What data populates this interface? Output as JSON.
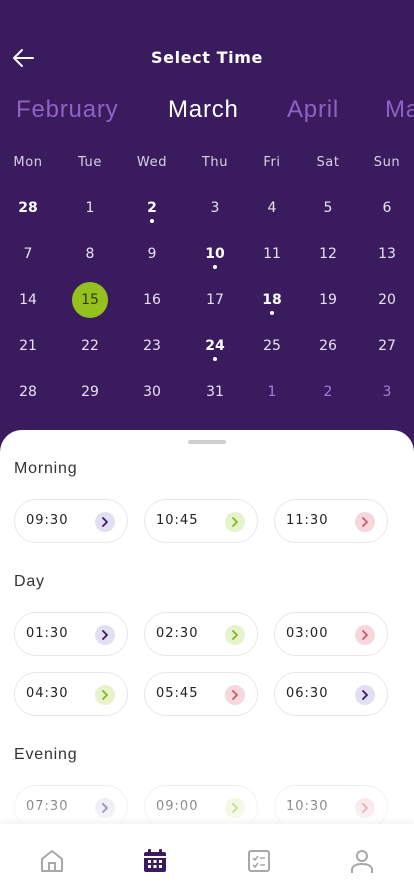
{
  "header": {
    "title": "Select Time",
    "months": [
      "February",
      "March",
      "April",
      "Ma"
    ],
    "active_month": "March",
    "weekdays": [
      "Mon",
      "Tue",
      "Wed",
      "Thu",
      "Fri",
      "Sat",
      "Sun"
    ]
  },
  "calendar": {
    "selected": "15",
    "weeks": [
      [
        {
          "d": "28",
          "bold": true
        },
        {
          "d": "1"
        },
        {
          "d": "2",
          "bold": true,
          "dot": true
        },
        {
          "d": "3"
        },
        {
          "d": "4"
        },
        {
          "d": "5"
        },
        {
          "d": "6"
        }
      ],
      [
        {
          "d": "7"
        },
        {
          "d": "8"
        },
        {
          "d": "9"
        },
        {
          "d": "10",
          "bold": true,
          "dot": true
        },
        {
          "d": "11"
        },
        {
          "d": "12"
        },
        {
          "d": "13"
        }
      ],
      [
        {
          "d": "14"
        },
        {
          "d": "15",
          "selected": true
        },
        {
          "d": "16"
        },
        {
          "d": "17"
        },
        {
          "d": "18",
          "bold": true,
          "dot": true
        },
        {
          "d": "19"
        },
        {
          "d": "20"
        }
      ],
      [
        {
          "d": "21"
        },
        {
          "d": "22"
        },
        {
          "d": "23"
        },
        {
          "d": "24",
          "bold": true,
          "dot": true
        },
        {
          "d": "25"
        },
        {
          "d": "26"
        },
        {
          "d": "27"
        }
      ],
      [
        {
          "d": "28"
        },
        {
          "d": "29"
        },
        {
          "d": "30"
        },
        {
          "d": "31"
        },
        {
          "d": "1",
          "other": true
        },
        {
          "d": "2",
          "other": true
        },
        {
          "d": "3",
          "other": true
        }
      ]
    ]
  },
  "sections": [
    {
      "title": "Morning",
      "slots": [
        {
          "time": "09:30",
          "status": "purple"
        },
        {
          "time": "10:45",
          "status": "green"
        },
        {
          "time": "11:30",
          "status": "pink"
        }
      ]
    },
    {
      "title": "Day",
      "slots": [
        {
          "time": "01:30",
          "status": "purple"
        },
        {
          "time": "02:30",
          "status": "green"
        },
        {
          "time": "03:00",
          "status": "pink"
        },
        {
          "time": "04:30",
          "status": "green"
        },
        {
          "time": "05:45",
          "status": "pink"
        },
        {
          "time": "06:30",
          "status": "purple"
        }
      ]
    },
    {
      "title": "Evening",
      "slots": [
        {
          "time": "07:30",
          "status": "purple"
        },
        {
          "time": "09:00",
          "status": "green"
        },
        {
          "time": "10:30",
          "status": "pink"
        }
      ]
    }
  ],
  "nav": [
    {
      "icon": "home-icon",
      "active": false
    },
    {
      "icon": "calendar-icon",
      "active": true
    },
    {
      "icon": "checklist-icon",
      "active": false
    },
    {
      "icon": "profile-icon",
      "active": false
    }
  ],
  "colors": {
    "background": "#3a1c5e",
    "selected_day": "#95c11f",
    "inactive_month": "#8f62c4",
    "chevron_purple": "#3a1c5e",
    "chevron_green": "#7fb81f",
    "chevron_pink": "#d0586a"
  }
}
